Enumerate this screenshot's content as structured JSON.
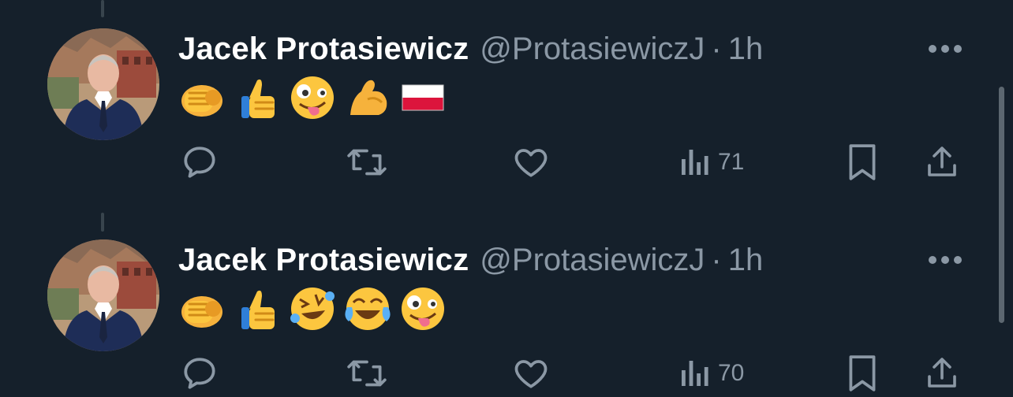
{
  "tweets": [
    {
      "author_name": "Jacek Protasiewicz",
      "handle": "@ProtasiewiczJ",
      "separator": "·",
      "time": "1h",
      "emojis": [
        "oncoming-fist",
        "thumbs-up",
        "zany-face",
        "flexed-biceps",
        "flag-poland"
      ],
      "views": "71"
    },
    {
      "author_name": "Jacek Protasiewicz",
      "handle": "@ProtasiewiczJ",
      "separator": "·",
      "time": "1h",
      "emojis": [
        "oncoming-fist",
        "thumbs-up",
        "rolling-on-floor-laughing",
        "face-with-tears-of-joy",
        "zany-face"
      ],
      "views": "70"
    }
  ],
  "colors": {
    "background": "#15202b",
    "text_primary": "#ffffff",
    "text_secondary": "#8b98a5",
    "thread_line": "#38444d"
  }
}
